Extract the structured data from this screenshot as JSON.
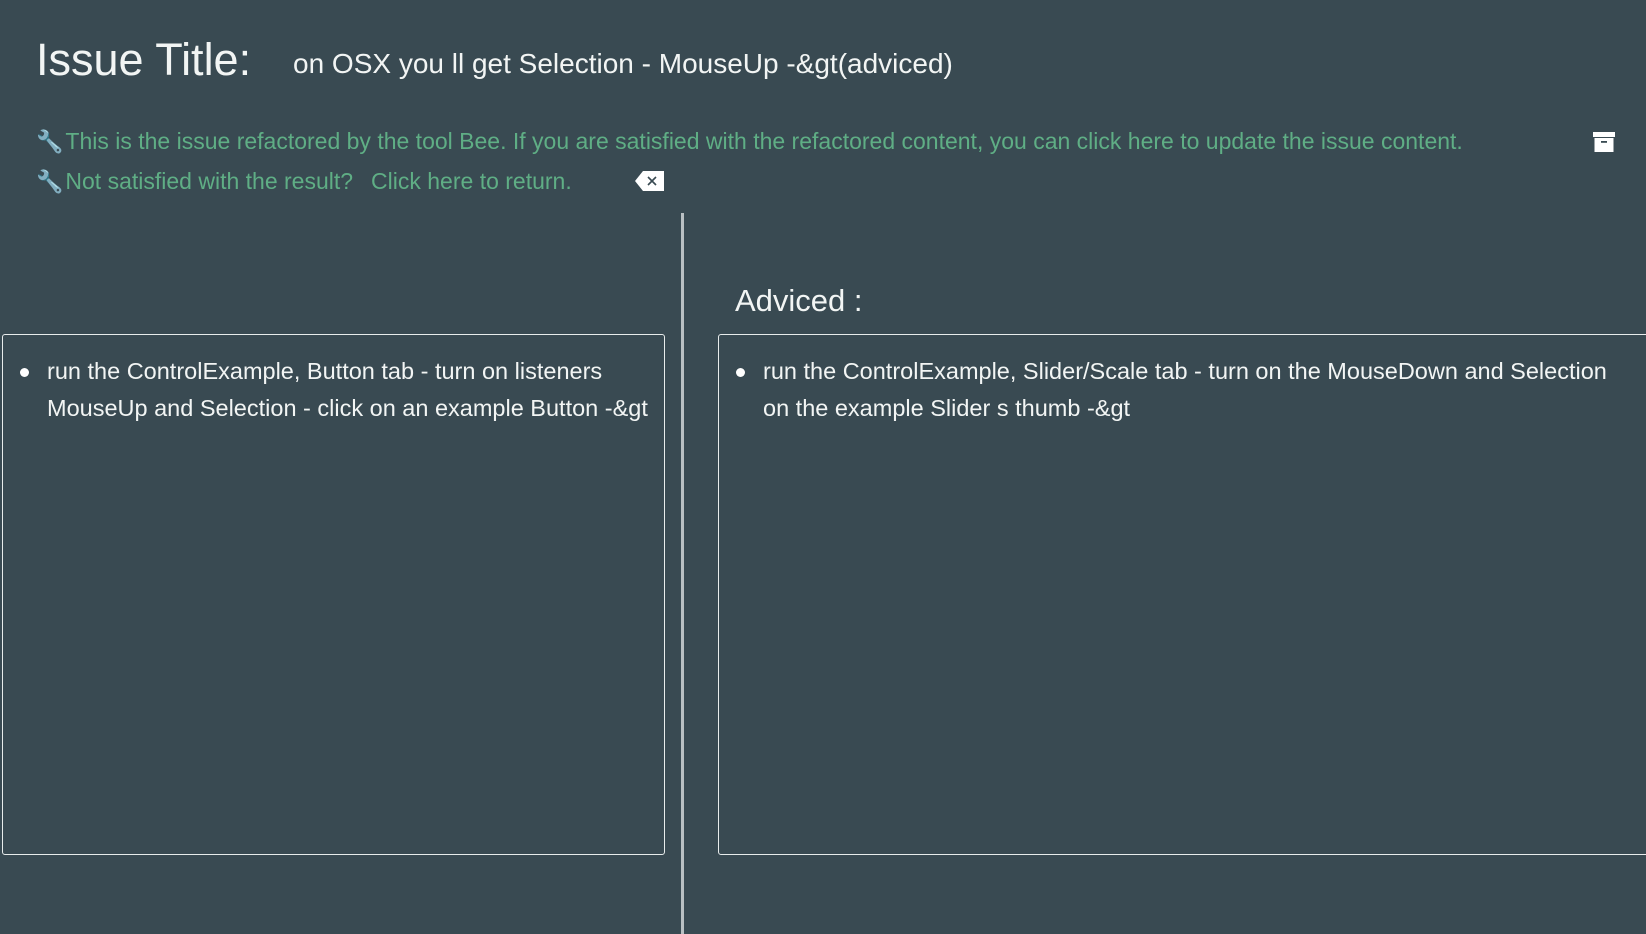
{
  "header": {
    "label": "Issue Title:",
    "title": "on OSX you ll get Selection - MouseUp -&gt(adviced)"
  },
  "notices": {
    "refactored": "This is the issue refactored by the tool Bee. If you are satisfied with the refactored content, you can click here to update the issue content.",
    "not_satisfied": "Not satisfied with the result?",
    "return_link": "Click here to return."
  },
  "original": {
    "items": [
      "run the ControlExample, Button tab - turn on listeners MouseUp and Selection - click on an example Button -&gt"
    ]
  },
  "advised": {
    "label": "Adviced :",
    "lines": [
      "run the ControlExample, Slider/Scale tab - turn on the MouseDown and Selection",
      "on the example Slider s thumb -&gt"
    ]
  },
  "colors": {
    "background": "#394a52",
    "accent": "#5fae85"
  }
}
